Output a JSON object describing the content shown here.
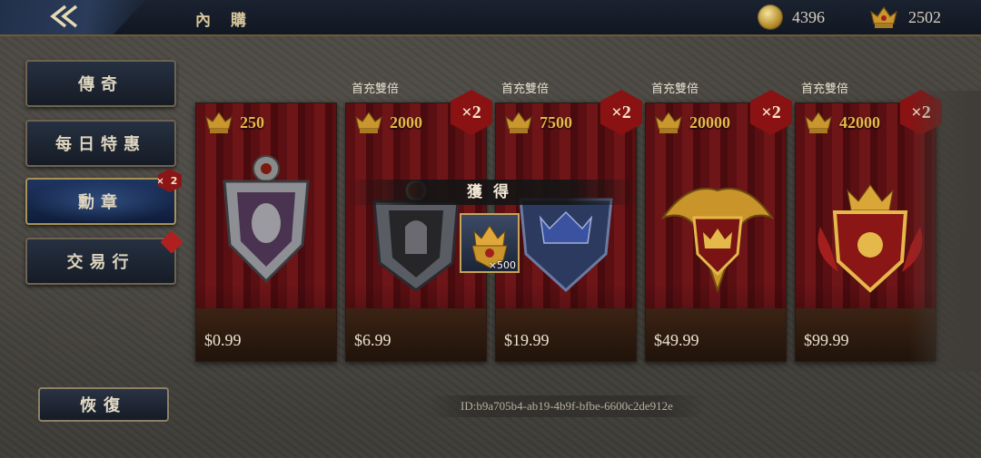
{
  "header": {
    "title": "內 購",
    "coins": "4396",
    "medals": "2502"
  },
  "sidebar": {
    "items": [
      {
        "label": "傳奇"
      },
      {
        "label": "每日特惠"
      },
      {
        "label": "勳章",
        "badge": "×2"
      },
      {
        "label": "交易行"
      }
    ],
    "restore_label": "恢復"
  },
  "cards": [
    {
      "amount": "250",
      "price": "$0.99",
      "double_label": "",
      "bonus": ""
    },
    {
      "amount": "2000",
      "price": "$6.99",
      "double_label": "首充雙倍",
      "bonus": "×2"
    },
    {
      "amount": "7500",
      "price": "$19.99",
      "double_label": "首充雙倍",
      "bonus": "×2"
    },
    {
      "amount": "20000",
      "price": "$49.99",
      "double_label": "首充雙倍",
      "bonus": "×2"
    },
    {
      "amount": "42000",
      "price": "$99.99",
      "double_label": "首充雙倍",
      "bonus": "×2"
    }
  ],
  "popup": {
    "title": "獲得",
    "qty": "×500"
  },
  "order_id": "ID:b9a705b4-ab19-4b9f-bfbe-6600c2de912e",
  "colors": {
    "accent_gold": "#e8b84a",
    "badge_red": "#8a1212",
    "topbar": "#151b27"
  }
}
